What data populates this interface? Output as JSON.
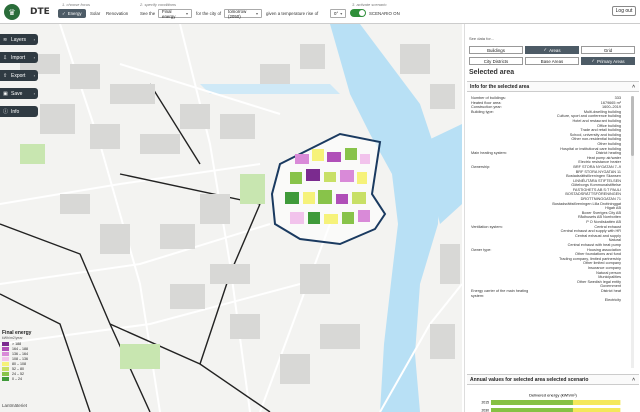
{
  "header": {
    "brand": "DTE",
    "step1": "1. choose focus",
    "step2": "2. specify conditions",
    "step3": "3. activate scenario",
    "focus_options": [
      "Energy",
      "Solar",
      "Renovation"
    ],
    "see_label": "See the",
    "measure_value": "Final energy",
    "city_label": "for the city of",
    "year_value": "tomorrow (2050)",
    "temp_label": "given a temperature rise of",
    "temp_value": "0°",
    "scenario_label": "SCENARIO ON",
    "logout_label": "Log out"
  },
  "menu": [
    {
      "label": "Layers",
      "icon": "layers-icon",
      "glyph": "≋"
    },
    {
      "label": "Import",
      "icon": "import-icon",
      "glyph": "⇩"
    },
    {
      "label": "Export",
      "icon": "export-icon",
      "glyph": "⇧"
    },
    {
      "label": "Save",
      "icon": "save-icon",
      "glyph": "▣"
    },
    {
      "label": "Info",
      "icon": "info-icon",
      "glyph": "ⓘ"
    }
  ],
  "legend": {
    "title": "Final energy",
    "unit": "kWh/m2/year",
    "rows": [
      {
        "label": "> 188",
        "color": "#7b2b8f"
      },
      {
        "label": "164 – 188",
        "color": "#b04fb8"
      },
      {
        "label": "136 – 164",
        "color": "#d98ad8"
      },
      {
        "label": "108 – 136",
        "color": "#f2c3ec"
      },
      {
        "label": "80 – 108",
        "color": "#f6f27a"
      },
      {
        "label": "52 – 80",
        "color": "#c8e066"
      },
      {
        "label": "24 – 52",
        "color": "#88c34a"
      },
      {
        "label": "0 – 24",
        "color": "#3f9a3a"
      }
    ]
  },
  "map_credit": "Lantmäteriet",
  "panel": {
    "hint": "See data for...",
    "tabs_row1": [
      "Buildings",
      "Areas",
      "Grid"
    ],
    "tabs_row2": [
      "City Districts",
      "Base Areas",
      "Primary Areas"
    ],
    "selected_title": "Selected area",
    "info_header": "Info for the selected area",
    "annual_header": "Annual values for selected area selected scenario",
    "info_rows": [
      {
        "k": "Number of buildings:",
        "v": "333"
      },
      {
        "k": "Heated floor area:",
        "v": "1679665 m²"
      },
      {
        "k": "Construction year:",
        "v": "1600–2019"
      },
      {
        "k": "Building type:",
        "v": "Multi-dwelling building"
      },
      {
        "k": "",
        "v": "Culture, sport and conference building"
      },
      {
        "k": "",
        "v": "Hotel and restaurant building"
      },
      {
        "k": "",
        "v": "Office building"
      },
      {
        "k": "",
        "v": "Trade and retail building"
      },
      {
        "k": "",
        "v": "School, university and building"
      },
      {
        "k": "",
        "v": "Other non-residential building"
      },
      {
        "k": "",
        "v": "Other building"
      },
      {
        "k": "",
        "v": "Hospital or institutional care building"
      },
      {
        "k": "Main heating system:",
        "v": "District heating"
      },
      {
        "k": "",
        "v": "Heat pump air/water"
      },
      {
        "k": "",
        "v": "Electric resistance heater"
      },
      {
        "k": "Ownership:",
        "v": "BRF STORA NYGATAN 7–9"
      },
      {
        "k": "",
        "v": "BRF STORA NYGATAN 11"
      },
      {
        "k": "",
        "v": "Bostadsrättsföreningen Skansen"
      },
      {
        "k": "",
        "v": "LINNÉUTÄRA STIFTELSEN"
      },
      {
        "k": "",
        "v": "Göteborgs Kommunalstiftelse"
      },
      {
        "k": "",
        "v": "FASTIGHETS AB S:T PAULI"
      },
      {
        "k": "",
        "v": "BOSTADSRÄTTSFÖRENINGEN DROTTNINGGATAN 71"
      },
      {
        "k": "",
        "v": "Bostadsrättsföreningen Lilla Drottninggat"
      },
      {
        "k": "",
        "v": "Higab AB"
      },
      {
        "k": "",
        "v": "Boxer Sveriges City AB"
      },
      {
        "k": "",
        "v": "Rådhusets AB Norrbotten"
      },
      {
        "k": "",
        "v": "P O Nordiskattén AB"
      },
      {
        "k": "Ventilation system:",
        "v": "Central exhaust"
      },
      {
        "k": "",
        "v": "Central exhaust and supply with HR"
      },
      {
        "k": "",
        "v": "Central exhaust and supply"
      },
      {
        "k": "",
        "v": "Natural"
      },
      {
        "k": "",
        "v": "Central exhaust with heat pump"
      },
      {
        "k": "Owner type:",
        "v": "Housing association"
      },
      {
        "k": "",
        "v": "Other foundations and fund"
      },
      {
        "k": "",
        "v": "Trading company, limited partnership"
      },
      {
        "k": "",
        "v": "Other limited company"
      },
      {
        "k": "",
        "v": "Insurance company"
      },
      {
        "k": "",
        "v": "Natural person"
      },
      {
        "k": "",
        "v": "Municipalities"
      },
      {
        "k": "",
        "v": "Other Swedish legal entity"
      },
      {
        "k": "",
        "v": "Government"
      },
      {
        "k": "Energy carrier of the main heating system:",
        "v": "District heat"
      },
      {
        "k": "",
        "v": "Electricity"
      }
    ]
  },
  "chart_data": {
    "type": "bar",
    "title": "Delivered energy (kWh/m²)",
    "categories": [
      "2015",
      "2030",
      "2040",
      "2050"
    ],
    "series": [
      {
        "values": [
          150,
          150,
          150,
          150
        ]
      },
      {
        "values": [
          95,
          95,
          93,
          90
        ]
      }
    ],
    "colors": [
      "#f4e85a",
      "#86c144"
    ],
    "xlim": [
      0,
      160
    ]
  }
}
